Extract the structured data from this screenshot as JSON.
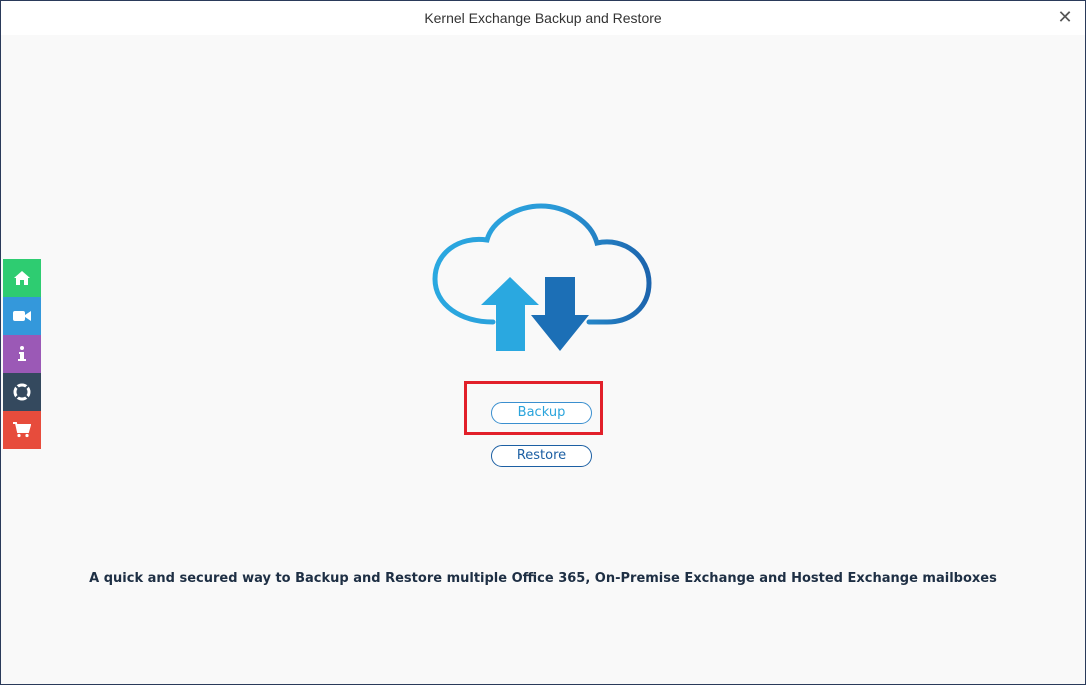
{
  "window": {
    "title": "Kernel Exchange Backup and Restore",
    "close_icon": "close-icon"
  },
  "sidebar": {
    "items": [
      {
        "name": "home",
        "icon": "home-icon",
        "color": "#2ecc71"
      },
      {
        "name": "video",
        "icon": "video-camera-icon",
        "color": "#3498db"
      },
      {
        "name": "info",
        "icon": "info-icon",
        "color": "#9b59b6"
      },
      {
        "name": "support",
        "icon": "lifebuoy-icon",
        "color": "#34495e"
      },
      {
        "name": "buy",
        "icon": "cart-icon",
        "color": "#e74c3c"
      }
    ]
  },
  "main": {
    "hero_icon": "cloud-upload-download-icon",
    "backup_label": "Backup",
    "restore_label": "Restore",
    "tagline": "A quick and secured way to Backup and Restore multiple Office 365, On-Premise Exchange and Hosted Exchange mailboxes"
  },
  "colors": {
    "highlight": "#e2202a",
    "accent_light": "#2aa4dc",
    "accent_dark": "#1c5fa3"
  }
}
